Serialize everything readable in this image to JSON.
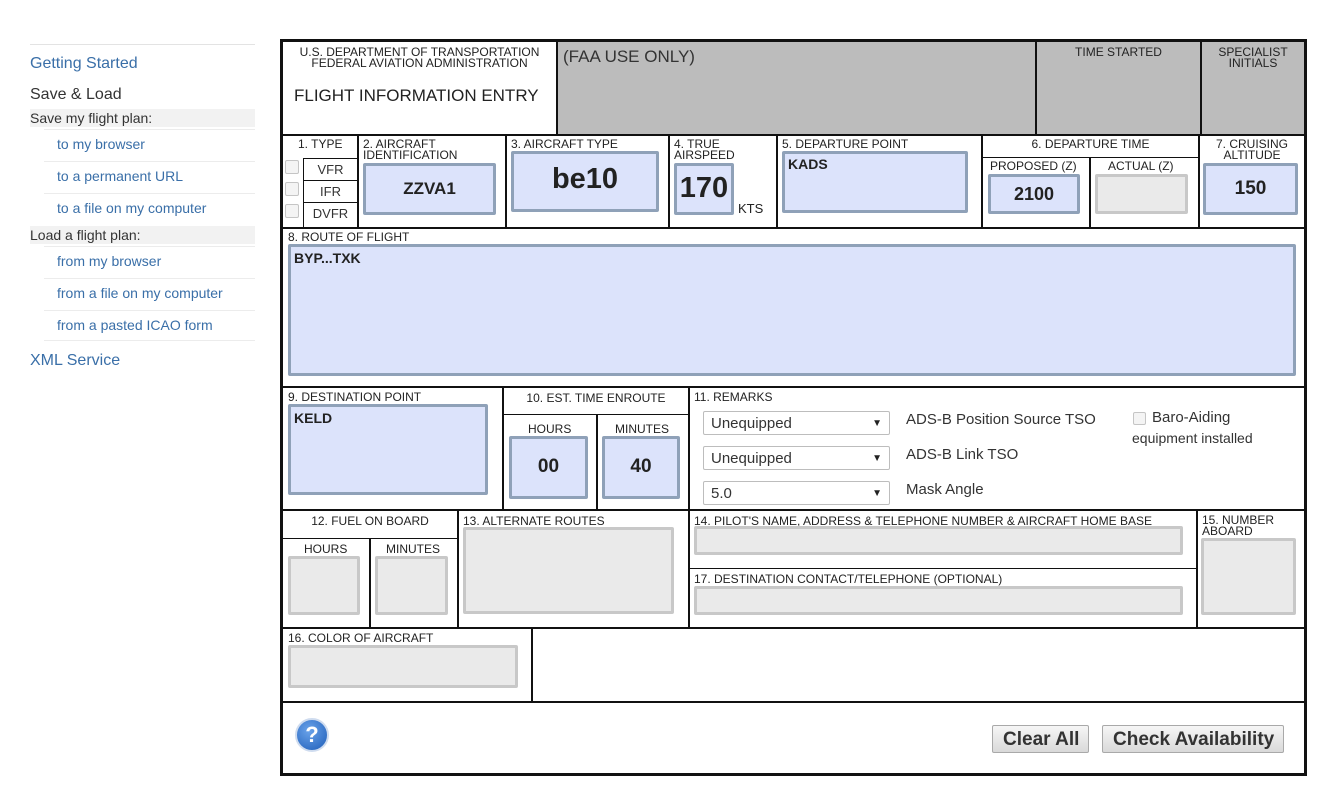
{
  "sidebar": {
    "getting_started": "Getting Started",
    "save_load": "Save & Load",
    "save_heading": "Save my flight plan:",
    "save_items": [
      "to my browser",
      "to a permanent URL",
      "to a file on my computer"
    ],
    "load_heading": "Load a flight plan:",
    "load_items": [
      "from my browser",
      "from a file on my computer",
      "from a pasted ICAO form"
    ],
    "xml_service": "XML Service"
  },
  "form": {
    "header": {
      "dept_line1": "U.S. DEPARTMENT OF TRANSPORTATION",
      "dept_line2": "FEDERAL AVIATION ADMINISTRATION",
      "title": "FLIGHT INFORMATION ENTRY",
      "faa_use": "(FAA USE ONLY)",
      "time_started": "TIME STARTED",
      "specialist_line1": "SPECIALIST",
      "specialist_line2": "INITIALS"
    },
    "type": {
      "label": "1. TYPE",
      "options": [
        "VFR",
        "IFR",
        "DVFR"
      ]
    },
    "aircraft_id": {
      "label_line1": "2. AIRCRAFT",
      "label_line2": "IDENTIFICATION",
      "value": "ZZVA1"
    },
    "aircraft_type": {
      "label": "3. AIRCRAFT TYPE",
      "value": "be10"
    },
    "airspeed": {
      "label_line1": "4. TRUE",
      "label_line2": "AIRSPEED",
      "value": "170",
      "unit": "KTS"
    },
    "departure_point": {
      "label": "5. DEPARTURE POINT",
      "value": "KADS"
    },
    "departure_time": {
      "label": "6. DEPARTURE TIME",
      "proposed_label": "PROPOSED (Z)",
      "proposed_value": "2100",
      "actual_label": "ACTUAL (Z)",
      "actual_value": ""
    },
    "cruising_altitude": {
      "label_line1": "7. CRUISING",
      "label_line2": "ALTITUDE",
      "value": "150"
    },
    "route": {
      "label": "8. ROUTE OF FLIGHT",
      "value": "BYP...TXK"
    },
    "destination": {
      "label": "9. DESTINATION POINT",
      "value": "KELD"
    },
    "ete": {
      "label": "10. EST. TIME ENROUTE",
      "hours_label": "HOURS",
      "hours_value": "00",
      "minutes_label": "MINUTES",
      "minutes_value": "40"
    },
    "remarks": {
      "label": "11. REMARKS",
      "position_source_value": "Unequipped",
      "position_source_label": "ADS-B Position Source TSO",
      "link_value": "Unequipped",
      "link_label": "ADS-B Link TSO",
      "mask_value": "5.0",
      "mask_label": "Mask Angle",
      "baro_line1": "Baro-Aiding",
      "baro_line2": "equipment installed"
    },
    "fuel": {
      "label": "12. FUEL ON BOARD",
      "hours_label": "HOURS",
      "minutes_label": "MINUTES"
    },
    "alternate": {
      "label": "13. ALTERNATE ROUTES"
    },
    "pilot": {
      "label": "14. PILOT'S NAME, ADDRESS & TELEPHONE NUMBER & AIRCRAFT HOME BASE"
    },
    "destination_contact": {
      "label": "17. DESTINATION CONTACT/TELEPHONE (OPTIONAL)"
    },
    "number_aboard": {
      "label_line1": "15. NUMBER",
      "label_line2": "ABOARD"
    },
    "color": {
      "label": "16. COLOR OF AIRCRAFT"
    },
    "buttons": {
      "help": "?",
      "clear_all": "Clear All",
      "check_availability": "Check Availability"
    }
  },
  "colors": {
    "field_fill": "#dce3fb",
    "field_border": "#8fa1b8",
    "faa_grey": "#bcbcbc",
    "link": "#3a6fa8"
  }
}
